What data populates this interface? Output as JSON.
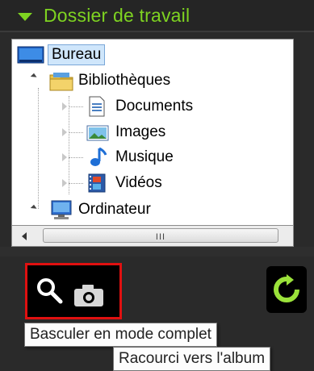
{
  "panel": {
    "title": "Dossier de travail",
    "accent_color": "#7ed321"
  },
  "tree": {
    "items": [
      {
        "label": "Bureau",
        "icon": "desktop-icon",
        "selected": true
      },
      {
        "label": "Bibliothèques",
        "icon": "libraries-folder-icon",
        "expanded": true
      },
      {
        "label": "Documents",
        "icon": "document-icon"
      },
      {
        "label": "Images",
        "icon": "picture-icon"
      },
      {
        "label": "Musique",
        "icon": "music-note-icon"
      },
      {
        "label": "Vidéos",
        "icon": "video-film-icon"
      },
      {
        "label": "Ordinateur",
        "icon": "computer-icon",
        "expanded": true
      }
    ]
  },
  "scrollbar": {
    "grip": "III"
  },
  "toolbar": {
    "search_button_icon": "search-magnifier-icon",
    "camera_icon": "camera-icon",
    "refresh_icon": "refresh-icon",
    "highlight_color": "#e01010"
  },
  "tooltips": {
    "primary": "Basculer en mode  complet",
    "secondary": "Racourci vers l'album"
  }
}
